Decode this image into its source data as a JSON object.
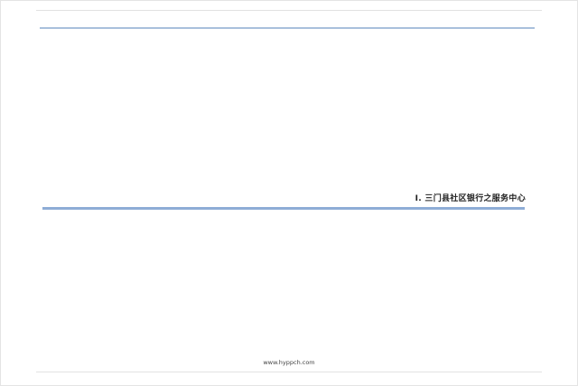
{
  "section": {
    "heading": "Ⅰ. 三门县社区银行之服务中心"
  },
  "footer": {
    "url": "www.hyppch.com"
  },
  "colors": {
    "rule_blue": "#8eadd6",
    "top_rule_blue": "#a9c0dc",
    "frame_gray": "#e4e4e4"
  }
}
